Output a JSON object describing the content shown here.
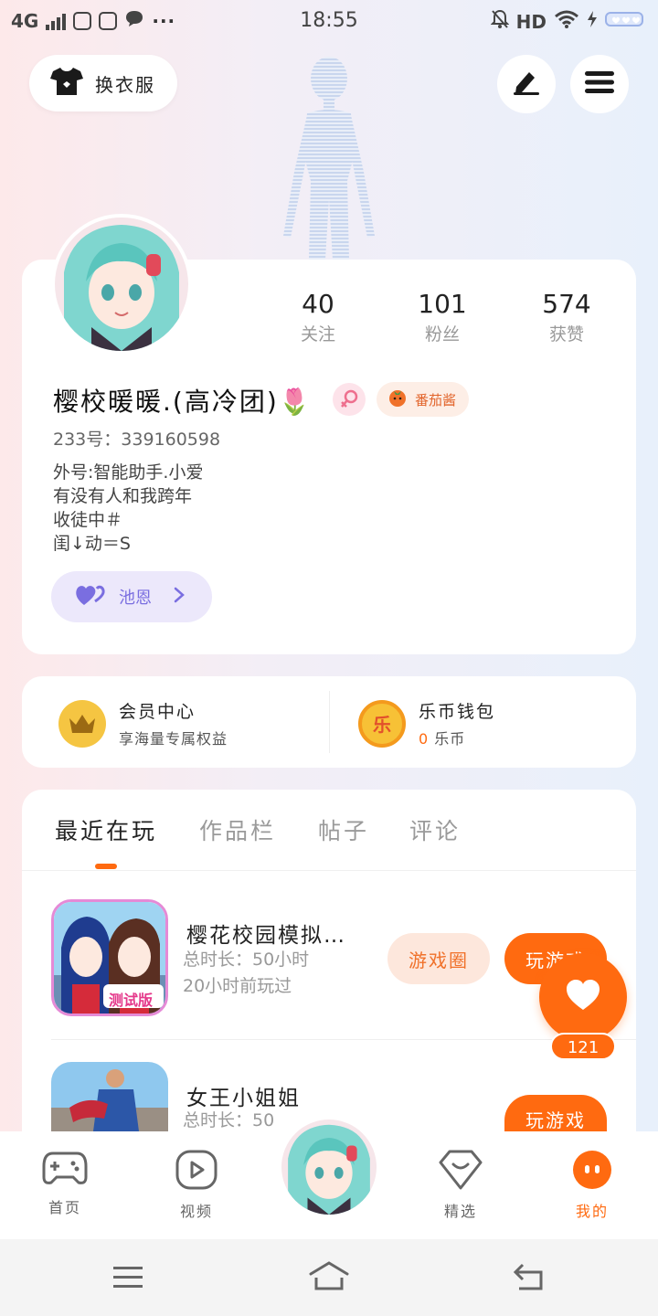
{
  "status_bar": {
    "network": "4G",
    "time": "18:55",
    "hd_label": "HD"
  },
  "top_buttons": {
    "outfit_label": "换衣服"
  },
  "profile": {
    "stats": [
      {
        "value": "40",
        "label": "关注"
      },
      {
        "value": "101",
        "label": "粉丝"
      },
      {
        "value": "574",
        "label": "获赞"
      }
    ],
    "nickname": "樱校暖暖.(高冷团)🌷",
    "badge_label": "番茄酱",
    "uid": "233号：339160598",
    "bio_lines": [
      "外号:智能助手.小爱",
      "有没有人和我跨年",
      "收徒中＃",
      "闺↓动＝S"
    ],
    "guild_label": "池恩"
  },
  "membership": {
    "vip_title": "会员中心",
    "vip_sub": "享海量专属权益",
    "wallet_title": "乐币钱包",
    "wallet_icon_char": "乐",
    "wallet_amount": "0",
    "wallet_unit": "乐币"
  },
  "tabs": [
    "最近在玩",
    "作品栏",
    "帖子",
    "评论"
  ],
  "games": [
    {
      "title": "樱花校园模拟…",
      "duration": "总时长：50小时",
      "last_played": "20小时前玩过",
      "circle_label": "游戏圈",
      "play_label": "玩游戏",
      "icon_badge": "测试版"
    },
    {
      "title": "女王小姐姐",
      "duration": "总时长：50",
      "play_label": "玩游戏"
    }
  ],
  "like_fab": {
    "count": "121"
  },
  "bottom_nav": [
    {
      "label": "首页"
    },
    {
      "label": "视频"
    },
    {
      "label": "精选"
    },
    {
      "label": "我的"
    }
  ],
  "colors": {
    "accent": "#ff6a10",
    "guild": "#7a6ee0",
    "vip_gold": "#f5c542"
  }
}
